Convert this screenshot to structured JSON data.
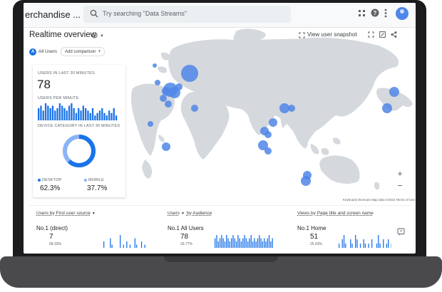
{
  "header": {
    "property_name": "erchandise ...",
    "search_placeholder": "Try searching \"Data Streams\""
  },
  "page": {
    "title": "Realtime overview",
    "view_snapshot": "View user snapshot"
  },
  "comparison": {
    "all_users": "All Users",
    "add_comparison": "Add comparison"
  },
  "summary": {
    "users_30_label": "USERS IN LAST 30 MINUTES",
    "users_30_value": "78",
    "per_minute_label": "USERS PER MINUTE",
    "per_minute_values": [
      5,
      6,
      4,
      7,
      6,
      5,
      6,
      4,
      5,
      7,
      6,
      5,
      4,
      6,
      7,
      5,
      3,
      5,
      4,
      6,
      5,
      4,
      3,
      5,
      2,
      3,
      4,
      5,
      3,
      2,
      4,
      3,
      5,
      2
    ],
    "device_label": "DEVICE CATEGORY IN LAST 30 MINUTES",
    "desktop_label": "DESKTOP",
    "desktop_value": "62.3%",
    "mobile_label": "MOBILE",
    "mobile_value": "37.7%",
    "desktop_share": 0.623,
    "desktop_color": "#1a73e8",
    "mobile_color": "#8ab4f8"
  },
  "map": {
    "attribution": "Keyboard shortcuts   Map data ©2022   Terms of Use"
  },
  "bottom_cards": [
    {
      "title_a": "Users by First user source",
      "title_b": "",
      "no1": "No.1 (direct)",
      "value": "7",
      "percent": "58.33%",
      "bars": [
        2,
        0,
        0,
        0,
        3,
        1,
        0,
        0,
        0,
        0,
        4,
        0,
        1,
        0,
        2,
        0,
        1,
        0,
        0,
        3,
        1,
        0,
        0,
        2,
        0,
        1,
        0,
        0,
        2,
        1,
        0,
        1,
        0,
        0,
        1,
        0,
        2
      ]
    },
    {
      "title_a": "Users",
      "title_b": "by Audience",
      "no1": "No.1 All Users",
      "value": "78",
      "percent": "33.77%",
      "bars": [
        3,
        4,
        2,
        3,
        4,
        3,
        2,
        4,
        3,
        2,
        3,
        4,
        3,
        2,
        4,
        3,
        2,
        3,
        4,
        3,
        2,
        3,
        4,
        2,
        3,
        2,
        3,
        4,
        3,
        2,
        3,
        2,
        3,
        4,
        2,
        3
      ]
    },
    {
      "title_a": "Views by Page title and screen name",
      "title_b": "",
      "no1": "No.1 Home",
      "value": "51",
      "percent": "25.63%",
      "bars": [
        1,
        0,
        2,
        3,
        1,
        0,
        0,
        2,
        1,
        0,
        3,
        2,
        0,
        1,
        0,
        2,
        1,
        0,
        1,
        0,
        2,
        0,
        0,
        1,
        3,
        1,
        0,
        2,
        0,
        1,
        2,
        0,
        1,
        0,
        3,
        1
      ]
    }
  ]
}
